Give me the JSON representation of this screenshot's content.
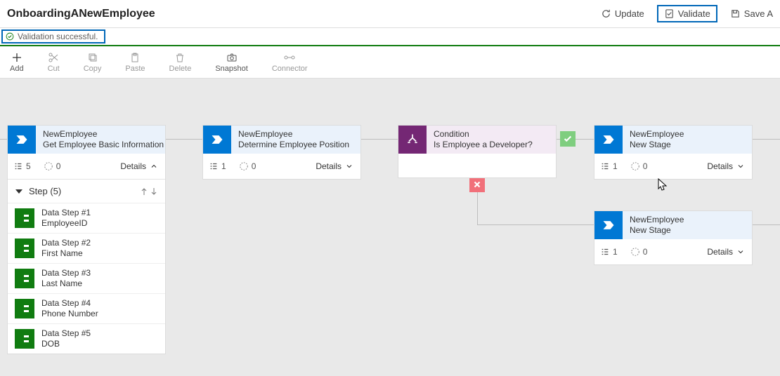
{
  "header": {
    "title": "OnboardingANewEmployee",
    "actions": {
      "update": "Update",
      "validate": "Validate",
      "save": "Save A"
    }
  },
  "notice": {
    "text": "Validation successful."
  },
  "toolbar": {
    "add": "Add",
    "cut": "Cut",
    "copy": "Copy",
    "paste": "Paste",
    "delete": "Delete",
    "snapshot": "Snapshot",
    "connector": "Connector"
  },
  "details_label": "Details",
  "stages": {
    "s1": {
      "entity": "NewEmployee",
      "name": "Get Employee Basic Information",
      "step_count": "5",
      "branch_count": "0",
      "steps_header": "Step (5)",
      "steps": [
        {
          "title": "Data Step #1",
          "sub": "EmployeeID"
        },
        {
          "title": "Data Step #2",
          "sub": "First Name"
        },
        {
          "title": "Data Step #3",
          "sub": "Last Name"
        },
        {
          "title": "Data Step #4",
          "sub": "Phone Number"
        },
        {
          "title": "Data Step #5",
          "sub": "DOB"
        }
      ]
    },
    "s2": {
      "entity": "NewEmployee",
      "name": "Determine Employee Position",
      "step_count": "1",
      "branch_count": "0"
    },
    "cond": {
      "entity": "Condition",
      "name": "Is Employee a Developer?"
    },
    "s3": {
      "entity": "NewEmployee",
      "name": "New Stage",
      "step_count": "1",
      "branch_count": "0"
    },
    "s4": {
      "entity": "NewEmployee",
      "name": "New Stage",
      "step_count": "1",
      "branch_count": "0"
    }
  }
}
